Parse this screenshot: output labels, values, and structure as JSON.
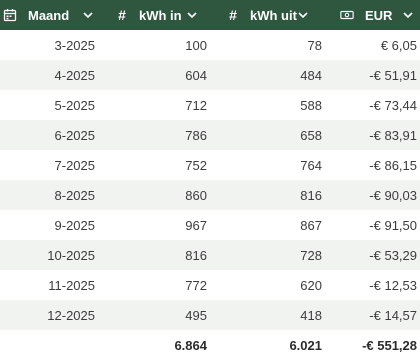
{
  "columns": [
    {
      "label": "Maand",
      "icon": "calendar-icon"
    },
    {
      "label": "kWh in",
      "icon": "hash-icon"
    },
    {
      "label": "kWh uit",
      "icon": "hash-icon"
    },
    {
      "label": "EUR",
      "icon": "banknote-icon"
    }
  ],
  "rows": [
    [
      "3-2025",
      "100",
      "78",
      "€ 6,05"
    ],
    [
      "4-2025",
      "604",
      "484",
      "-€ 51,91"
    ],
    [
      "5-2025",
      "712",
      "588",
      "-€ 73,44"
    ],
    [
      "6-2025",
      "786",
      "658",
      "-€ 83,91"
    ],
    [
      "7-2025",
      "752",
      "764",
      "-€ 86,15"
    ],
    [
      "8-2025",
      "860",
      "816",
      "-€ 90,03"
    ],
    [
      "9-2025",
      "967",
      "867",
      "-€ 91,50"
    ],
    [
      "10-2025",
      "816",
      "728",
      "-€ 53,29"
    ],
    [
      "11-2025",
      "772",
      "620",
      "-€ 12,53"
    ],
    [
      "12-2025",
      "495",
      "418",
      "-€ 14,57"
    ]
  ],
  "totals": [
    "",
    "6.864",
    "6.021",
    "-€ 551,28"
  ],
  "colors": {
    "header_bg": "#2f5740",
    "row_alt": "#f1f3f1"
  }
}
